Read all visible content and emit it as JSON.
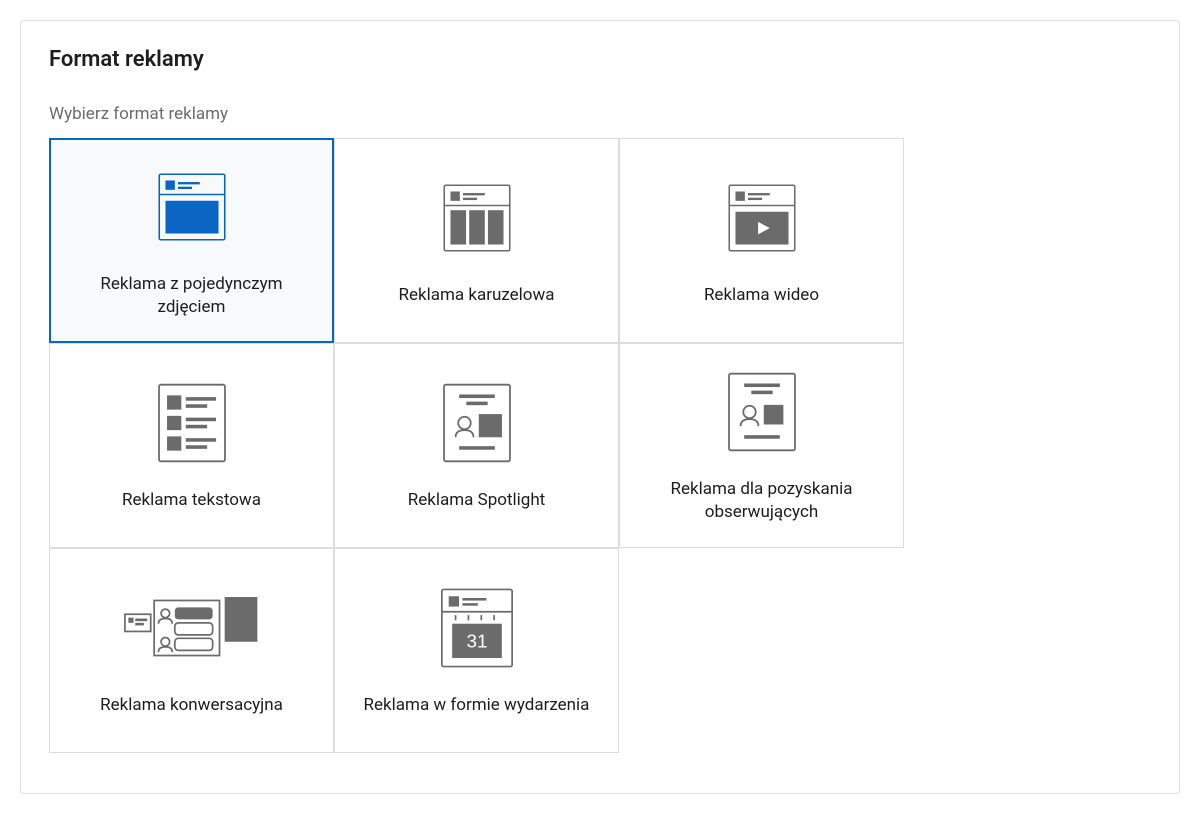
{
  "panel": {
    "title": "Format reklamy",
    "subtitle": "Wybierz format reklamy"
  },
  "cards": {
    "single_image": {
      "label": "Reklama z pojedynczym zdjęciem",
      "selected": true
    },
    "carousel": {
      "label": "Reklama karuzelowa"
    },
    "video": {
      "label": "Reklama wideo"
    },
    "text": {
      "label": "Reklama tekstowa"
    },
    "spotlight": {
      "label": "Reklama Spotlight"
    },
    "follower": {
      "label": "Reklama dla pozyskania obserwujących"
    },
    "conversation": {
      "label": "Reklama konwersacyjna"
    },
    "event": {
      "label": "Reklama w formie wydarzenia",
      "calendar_day": "31"
    }
  }
}
